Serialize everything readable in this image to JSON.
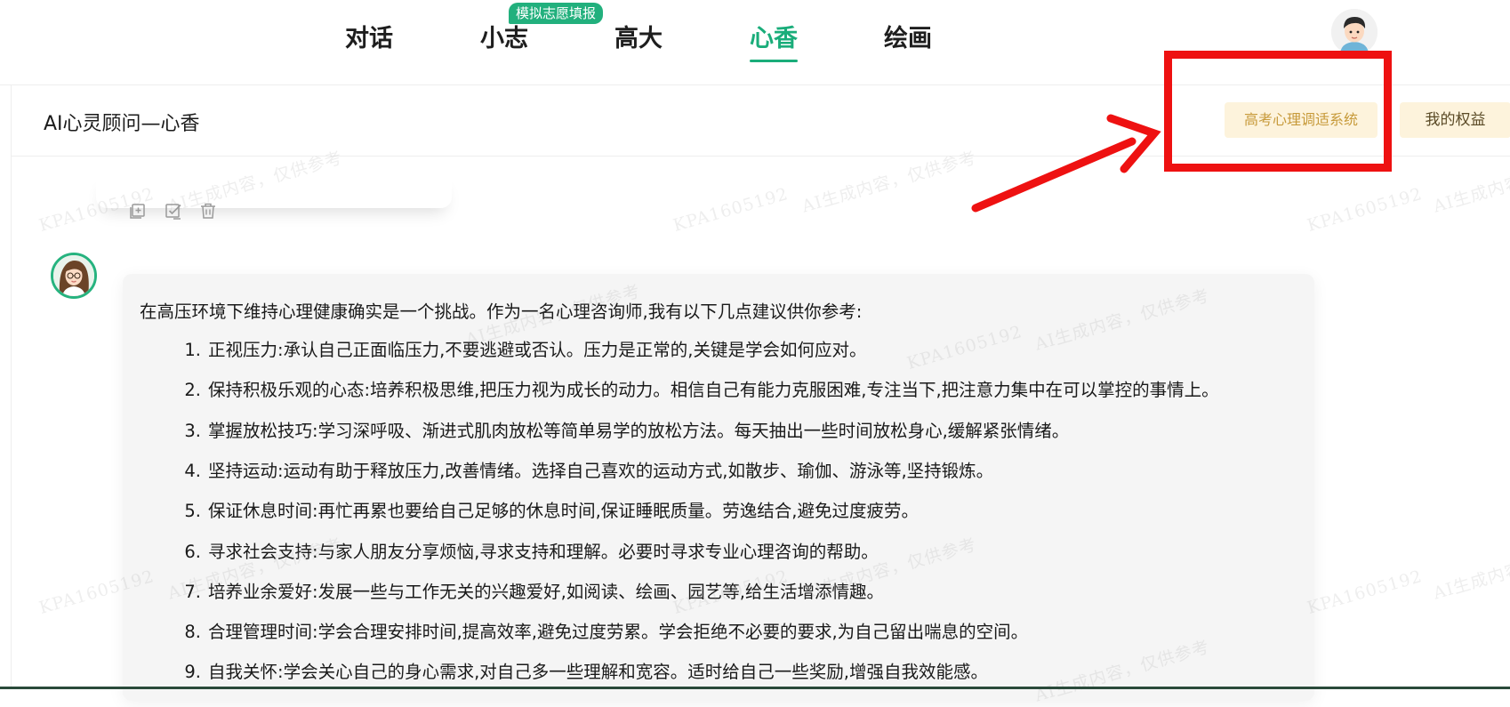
{
  "nav": {
    "tabs": [
      {
        "label": "对话"
      },
      {
        "label": "小志"
      },
      {
        "label": "高大"
      },
      {
        "label": "心香"
      },
      {
        "label": "绘画"
      }
    ],
    "active": "心香",
    "badge": "模拟志愿填报"
  },
  "header": {
    "title": "AI心灵顾问—心香",
    "system_button": "高考心理调适系统",
    "rights_button": "我的权益"
  },
  "message": {
    "intro": "在高压环境下维持心理健康确实是一个挑战。作为一名心理咨询师,我有以下几点建议供你参考:",
    "tips": [
      {
        "num": "1.",
        "text": "正视压力:承认自己正面临压力,不要逃避或否认。压力是正常的,关键是学会如何应对。"
      },
      {
        "num": "2.",
        "text": "保持积极乐观的心态:培养积极思维,把压力视为成长的动力。相信自己有能力克服困难,专注当下,把注意力集中在可以掌控的事情上。"
      },
      {
        "num": "3.",
        "text": "掌握放松技巧:学习深呼吸、渐进式肌肉放松等简单易学的放松方法。每天抽出一些时间放松身心,缓解紧张情绪。"
      },
      {
        "num": "4.",
        "text": "坚持运动:运动有助于释放压力,改善情绪。选择自己喜欢的运动方式,如散步、瑜伽、游泳等,坚持锻炼。"
      },
      {
        "num": "5.",
        "text": "保证休息时间:再忙再累也要给自己足够的休息时间,保证睡眠质量。劳逸结合,避免过度疲劳。"
      },
      {
        "num": "6.",
        "text": "寻求社会支持:与家人朋友分享烦恼,寻求支持和理解。必要时寻求专业心理咨询的帮助。"
      },
      {
        "num": "7.",
        "text": "培养业余爱好:发展一些与工作无关的兴趣爱好,如阅读、绘画、园艺等,给生活增添情趣。"
      },
      {
        "num": "8.",
        "text": "合理管理时间:学会合理安排时间,提高效率,避免过度劳累。学会拒绝不必要的要求,为自己留出喘息的空间。"
      },
      {
        "num": "9.",
        "text": "自我关怀:学会关心自己的身心需求,对自己多一些理解和宽容。适时给自己一些奖励,增强自我效能感。"
      }
    ]
  },
  "watermark": {
    "code": "KPA1605192",
    "notice": "AI生成内容，仅供参考"
  },
  "icons": {
    "copy": "add-square-icon",
    "select": "checkbox-edit-icon",
    "delete": "trash-icon"
  },
  "colors": {
    "accent": "#1aad7a",
    "annotation": "#ee1111",
    "soft_button": "#fdf3dc"
  }
}
